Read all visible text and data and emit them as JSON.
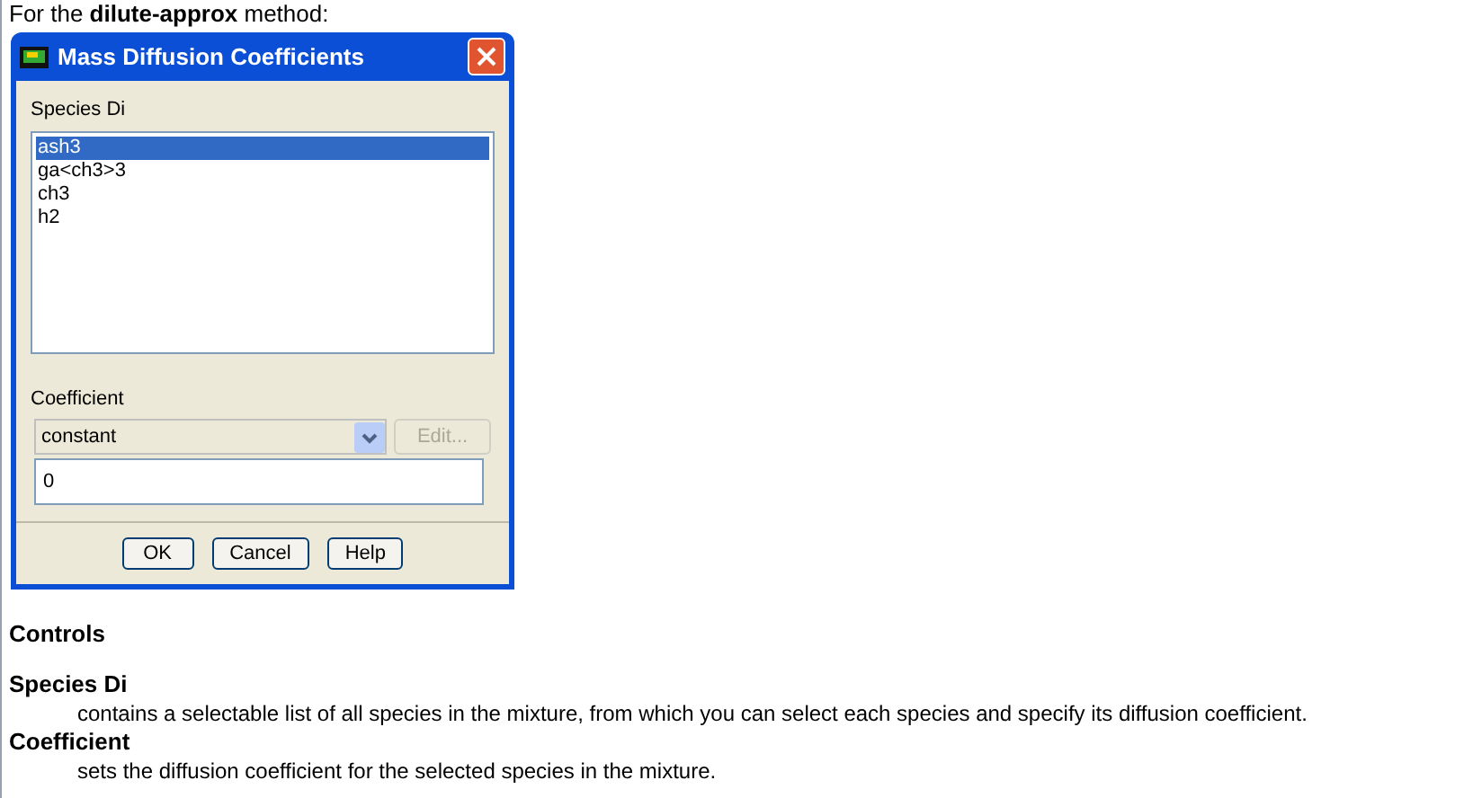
{
  "intro": "For the **dilute-approx** method:",
  "dialog": {
    "title": "Mass Diffusion Coefficients",
    "species_label": "Species Di",
    "species": [
      {
        "label": "ash3",
        "selected": true
      },
      {
        "label": "ga<ch3>3",
        "selected": false
      },
      {
        "label": "ch3",
        "selected": false
      },
      {
        "label": "h2",
        "selected": false
      }
    ],
    "coefficient_label": "Coefficient",
    "method": "constant",
    "edit_button": {
      "label": "Edit...",
      "disabled": true
    },
    "value": "0",
    "buttons": [
      "OK",
      "Cancel",
      "Help"
    ]
  },
  "controls_heading": "Controls",
  "definitions": [
    {
      "term": "Species Di",
      "text": "contains a selectable list of all species in the mixture, from which you can select each species and specify its diffusion coefficient."
    },
    {
      "term": "Coefficient",
      "text": "sets the diffusion coefficient for the selected species in the mixture."
    }
  ]
}
